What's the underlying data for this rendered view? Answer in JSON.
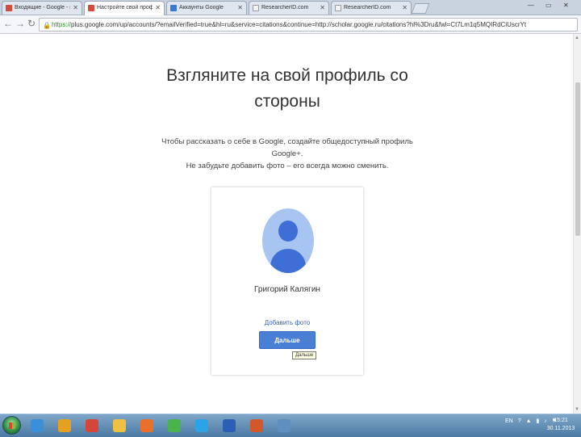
{
  "browser": {
    "tabs": [
      {
        "label": "Входящие - Google - подписки",
        "favicon_color": "#d54a3a"
      },
      {
        "label": "Настройте свой профиль",
        "favicon_color": "#d54a3a",
        "active": true
      },
      {
        "label": "Аккаунты Google",
        "favicon_color": "#3a77d9"
      },
      {
        "label": "ResearcherID.com",
        "favicon_color": "#f4f4f4"
      },
      {
        "label": "ResearcherID.com",
        "favicon_color": "#f4f4f4"
      }
    ],
    "url_scheme": "https://",
    "url_rest": "plus.google.com/up/accounts/?emailVerified=true&hl=ru&service=citations&continue=http://scholar.google.ru/citations?hl%3Dru&fwl=Ct7Lm1q5MQIRdCiUscrYt"
  },
  "page": {
    "title_line1": "Взгляните на свой профиль со",
    "title_line2": "стороны",
    "subtitle_line1": "Чтобы рассказать о себе в Google, создайте общедоступный профиль",
    "subtitle_line2": "Google+.",
    "subtitle_line3": "Не забудьте добавить фото – его всегда можно сменить.",
    "profile_name": "Григорий Калягин",
    "add_photo_link": "Добавить фото",
    "next_button": "Дальше",
    "next_tooltip": "Дальше"
  },
  "taskbar": {
    "apps": [
      {
        "icon": "ie-icon",
        "color": "#3a8fd9"
      },
      {
        "icon": "media-player-icon",
        "color": "#e6a020"
      },
      {
        "icon": "chrome-icon",
        "color": "#d6453a"
      },
      {
        "icon": "file-manager-icon",
        "color": "#f0c040"
      },
      {
        "icon": "firefox-icon",
        "color": "#e8702a"
      },
      {
        "icon": "icq-icon",
        "color": "#4bb34b"
      },
      {
        "icon": "skype-icon",
        "color": "#2aa3e8"
      },
      {
        "icon": "word-icon",
        "color": "#2b5fb3"
      },
      {
        "icon": "powerpoint-icon",
        "color": "#d2572b"
      },
      {
        "icon": "image-viewer-icon",
        "color": "#5f8fbf"
      }
    ],
    "language": "EN",
    "clock_time": "15:21",
    "clock_date": "30.11.2013"
  }
}
